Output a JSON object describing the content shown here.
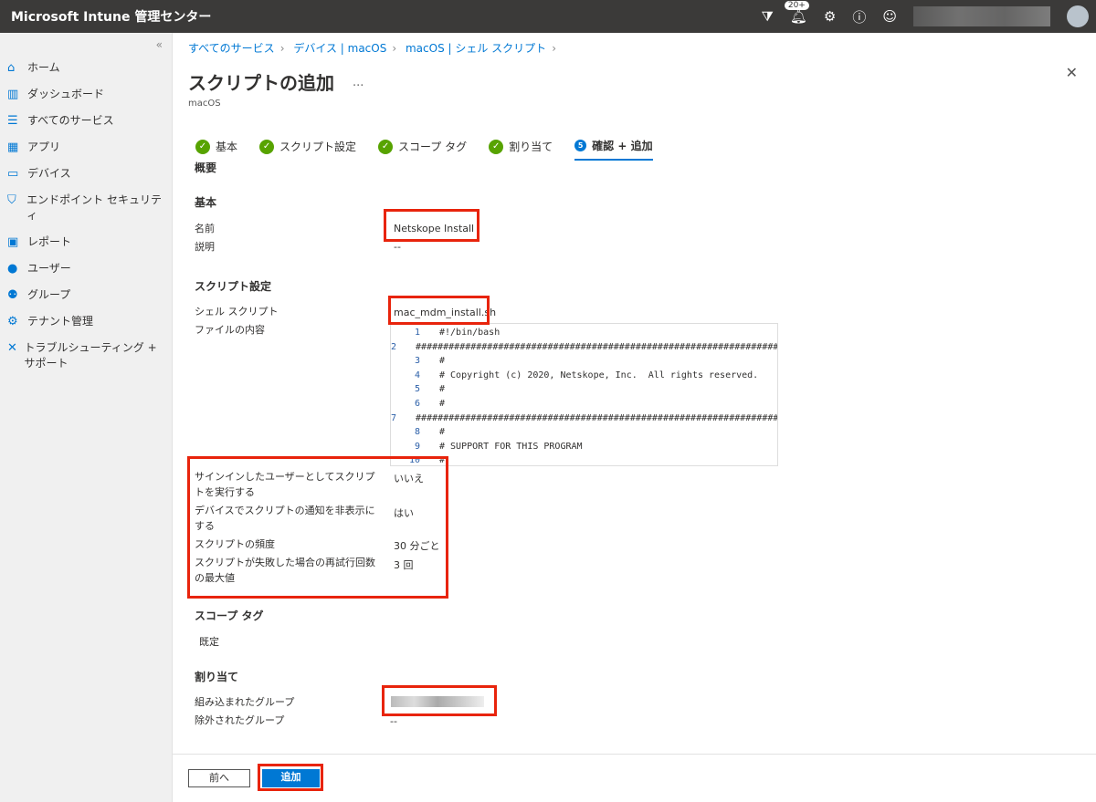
{
  "header": {
    "title": "Microsoft Intune 管理センター",
    "notifications": "20+"
  },
  "sidebar": {
    "items": [
      {
        "label": "ホーム",
        "icon": "⌂"
      },
      {
        "label": "ダッシュボード",
        "icon": "▥"
      },
      {
        "label": "すべてのサービス",
        "icon": "☰"
      },
      {
        "label": "アプリ",
        "icon": "▦"
      },
      {
        "label": "デバイス",
        "icon": "▭"
      },
      {
        "label": "エンドポイント セキュリティ",
        "icon": "⛉"
      },
      {
        "label": "レポート",
        "icon": "▣"
      },
      {
        "label": "ユーザー",
        "icon": "●"
      },
      {
        "label": "グループ",
        "icon": "⚉"
      },
      {
        "label": "テナント管理",
        "icon": "⚙"
      },
      {
        "label": "トラブルシューティング + サポート",
        "icon": "✕"
      }
    ]
  },
  "breadcrumb": [
    "すべてのサービス",
    "デバイス | macOS",
    "macOS | シェル スクリプト"
  ],
  "page": {
    "title": "スクリプトの追加",
    "subtitle": "macOS",
    "more": "···"
  },
  "steps": [
    {
      "label": "基本"
    },
    {
      "label": "スクリプト設定"
    },
    {
      "label": "スコープ タグ"
    },
    {
      "label": "割り当て"
    },
    {
      "label": "確認 + 追加",
      "num": "5"
    }
  ],
  "summary": {
    "overview": "概要",
    "basics": {
      "heading": "基本",
      "name_label": "名前",
      "name": "Netskope Install",
      "desc_label": "説明",
      "desc": "--"
    },
    "script": {
      "heading": "スクリプト設定",
      "shell_label": "シェル スクリプト",
      "shell": "mac_mdm_install.sh",
      "content_label": "ファイルの内容",
      "lines": [
        "#!/bin/bash",
        "##############################################################################",
        "#",
        "# Copyright (c) 2020, Netskope, Inc.  All rights reserved.",
        "#",
        "#",
        "##############################################################################",
        "#",
        "# SUPPORT FOR THIS PROGRAM",
        "#"
      ],
      "run_as_label": "サインインしたユーザーとしてスクリプトを実行する",
      "run_as": "いいえ",
      "hide_label": "デバイスでスクリプトの通知を非表示にする",
      "hide": "はい",
      "freq_label": "スクリプトの頻度",
      "freq": "30 分ごと",
      "retry_label": "スクリプトが失敗した場合の再試行回数の最大値",
      "retry": "3 回"
    },
    "scope": {
      "heading": "スコープ タグ",
      "value": "既定"
    },
    "assign": {
      "heading": "割り当て",
      "included_label": "組み込まれたグループ",
      "excluded_label": "除外されたグループ",
      "excluded": "--"
    }
  },
  "footer": {
    "prev": "前へ",
    "add": "追加"
  }
}
